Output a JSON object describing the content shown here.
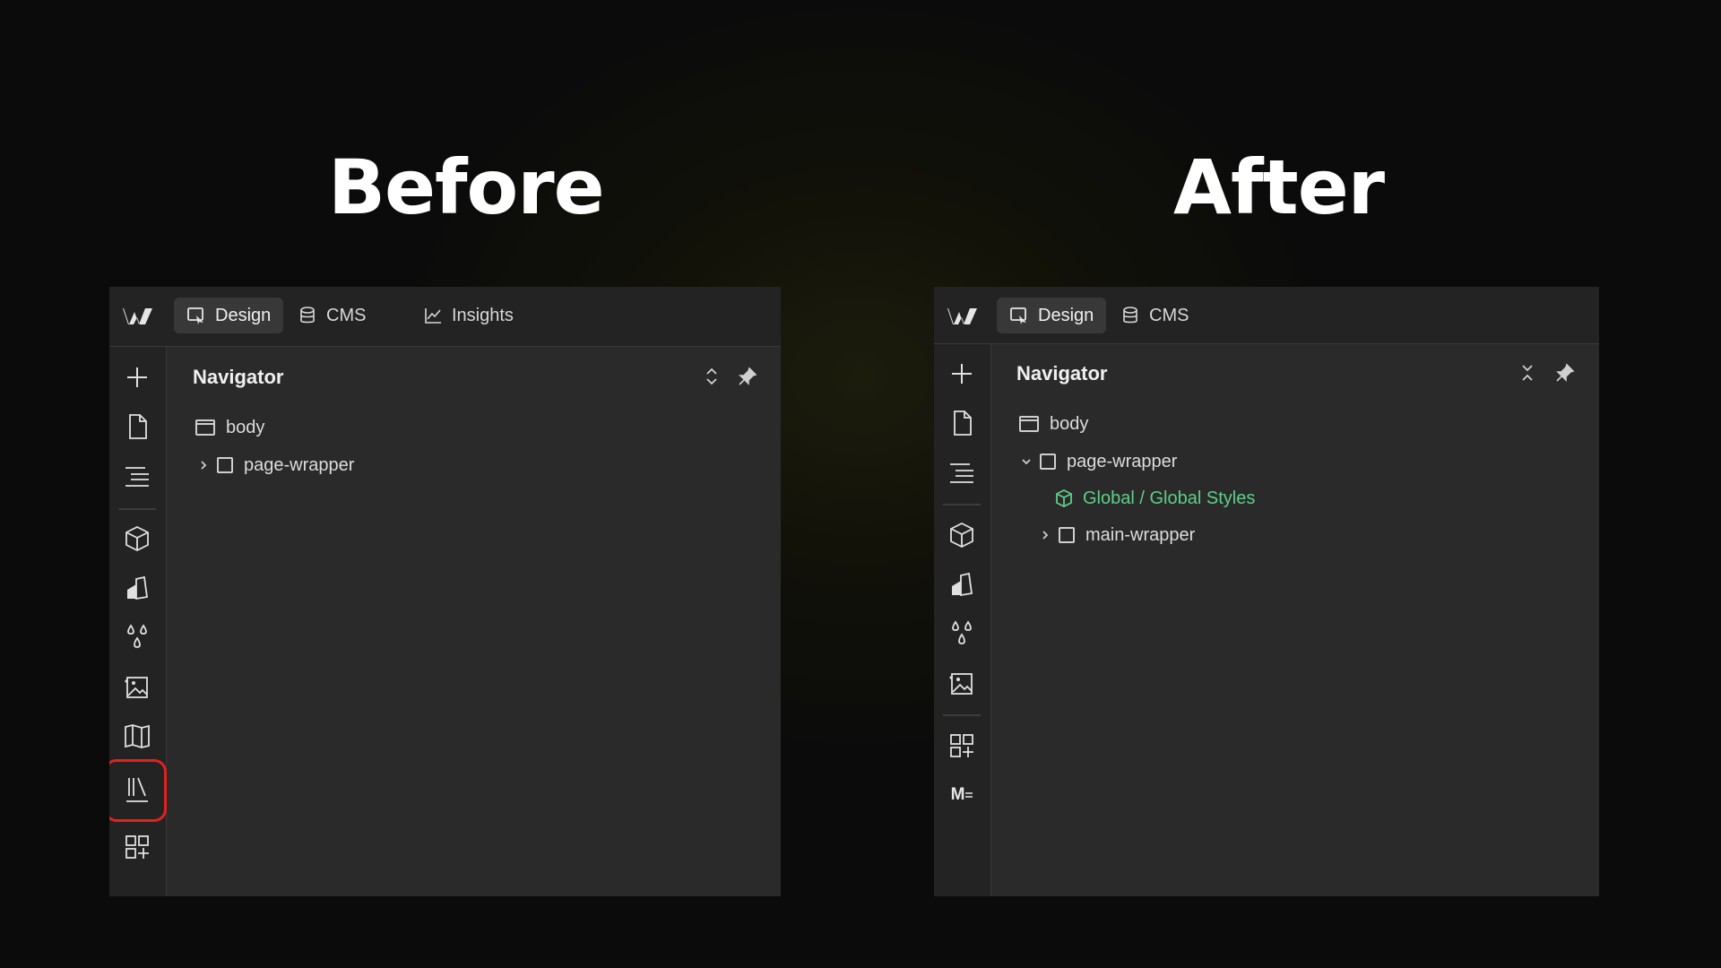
{
  "headings": {
    "before": "Before",
    "after": "After"
  },
  "before": {
    "tabs": [
      {
        "label": "Design",
        "icon": "cursor-select-icon",
        "active": true
      },
      {
        "label": "CMS",
        "icon": "database-icon",
        "active": false
      },
      {
        "label": "Insights",
        "icon": "line-chart-icon",
        "active": false
      }
    ],
    "rail_icons": [
      "plus-icon",
      "page-icon",
      "navigator-icon",
      "components-icon",
      "style-selector-icon",
      "variables-icon",
      "assets-icon",
      "book-icon",
      "library-icon",
      "apps-icon"
    ],
    "highlighted_icon": "library-icon",
    "navigator": {
      "title": "Navigator",
      "tree": [
        {
          "label": "body",
          "type": "body"
        },
        {
          "label": "page-wrapper",
          "type": "div",
          "expanded": false
        }
      ]
    }
  },
  "after": {
    "tabs": [
      {
        "label": "Design",
        "icon": "cursor-select-icon",
        "active": true
      },
      {
        "label": "CMS",
        "icon": "database-icon",
        "active": false
      }
    ],
    "rail_icons": [
      "plus-icon",
      "page-icon",
      "navigator-icon",
      "components-icon",
      "style-selector-icon",
      "variables-icon",
      "assets-icon",
      "apps-icon",
      "markdown-icon"
    ],
    "markdown_label": "M",
    "navigator": {
      "title": "Navigator",
      "tree": [
        {
          "label": "body",
          "type": "body"
        },
        {
          "label": "page-wrapper",
          "type": "div",
          "expanded": true
        },
        {
          "label": "Global / Global Styles",
          "type": "component"
        },
        {
          "label": "main-wrapper",
          "type": "div",
          "expanded": false
        }
      ]
    }
  },
  "colors": {
    "highlight": "#e3211d",
    "component_green": "#5fcf85",
    "panel_bg": "#2a2a2b"
  }
}
